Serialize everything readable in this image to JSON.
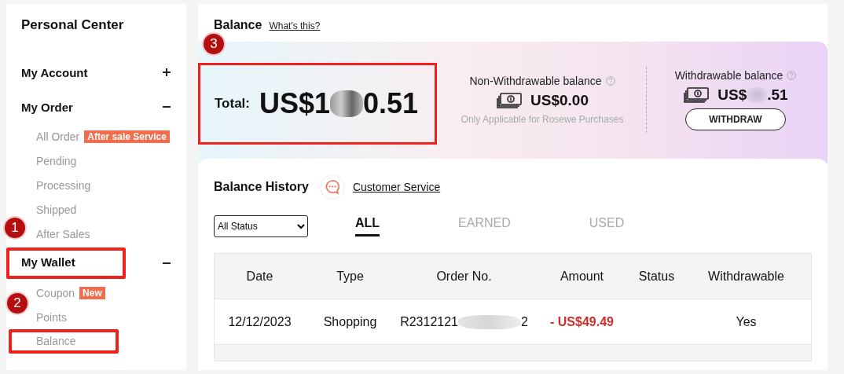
{
  "sidebar": {
    "title": "Personal Center",
    "sections": [
      {
        "label": "My Account",
        "expanded": false,
        "highlighted": false
      },
      {
        "label": "My Order",
        "expanded": true,
        "highlighted": false,
        "children": [
          {
            "label": "All Order",
            "badge": "After sale Service",
            "highlighted": false
          },
          {
            "label": "Pending",
            "highlighted": false
          },
          {
            "label": "Processing",
            "highlighted": false
          },
          {
            "label": "Shipped",
            "highlighted": false
          },
          {
            "label": "After Sales",
            "highlighted": false
          }
        ]
      },
      {
        "label": "My Wallet",
        "expanded": true,
        "highlighted": true,
        "callout": "1",
        "children": [
          {
            "label": "Coupon",
            "badge": "New",
            "highlighted": false
          },
          {
            "label": "Points",
            "highlighted": false
          },
          {
            "label": "Balance",
            "highlighted": true,
            "callout": "2"
          }
        ]
      }
    ]
  },
  "balance": {
    "title": "Balance",
    "help_link": "What's this?",
    "total": {
      "label": "Total:",
      "amount_start": "US$1",
      "amount_end": "0.51",
      "redacted": true,
      "highlighted": true,
      "callout": "3"
    },
    "non_withdrawable": {
      "label": "Non-Withdrawable balance",
      "amount_start": "US$0.00",
      "redacted": false,
      "note": "Only Applicable for Rosewe Purchases"
    },
    "withdrawable": {
      "label": "Withdrawable balance",
      "amount_start": "US$",
      "amount_end": ".51",
      "redacted": true,
      "button": "WITHDRAW"
    }
  },
  "history": {
    "title": "Balance History",
    "service_link": "Customer Service",
    "status_select": "All Status",
    "tabs": [
      {
        "label": "ALL",
        "selected": true
      },
      {
        "label": "EARNED",
        "selected": false
      },
      {
        "label": "USED",
        "selected": false
      }
    ],
    "columns": [
      "Date",
      "Type",
      "Order No.",
      "Amount",
      "Status",
      "Withdrawable"
    ],
    "rows": [
      {
        "date": "12/12/2023",
        "type": "Shopping",
        "order_start": "R2312121",
        "order_end": "2",
        "redacted": true,
        "amount": "- US$49.49",
        "status": "",
        "withdrawable": "Yes"
      }
    ]
  }
}
